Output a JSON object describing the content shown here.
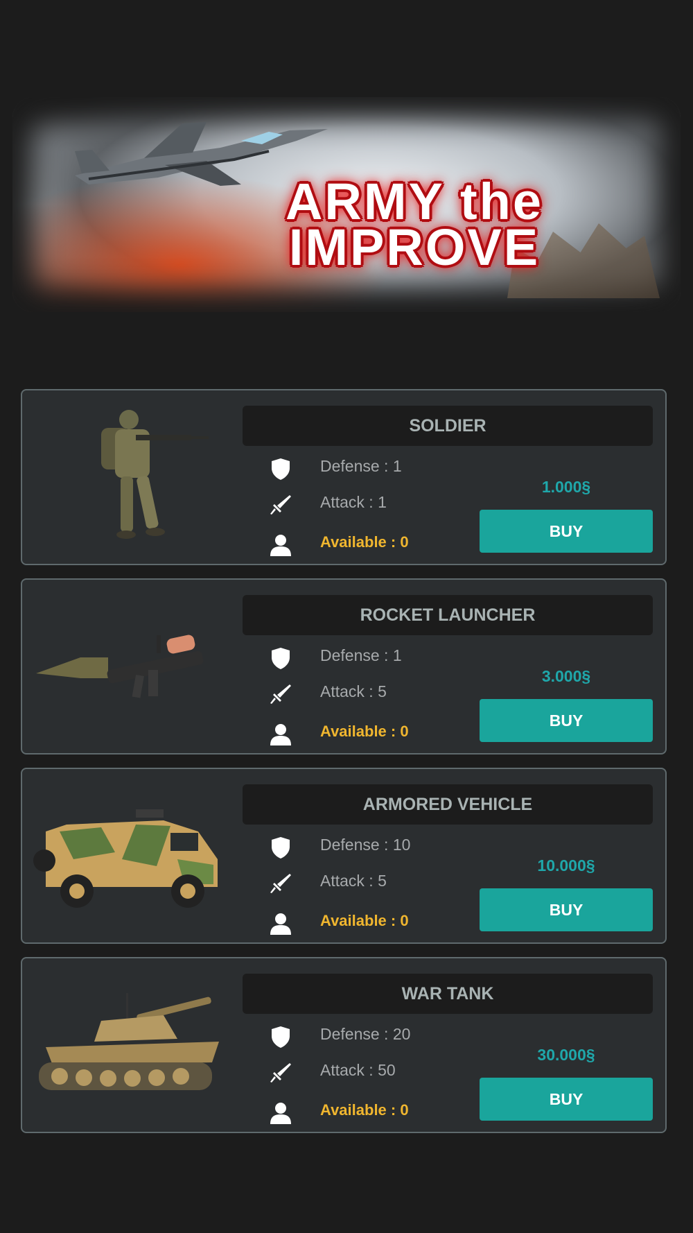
{
  "banner": {
    "title_line1": "ARMY the",
    "title_line2": "IMPROVE"
  },
  "colors": {
    "background": "#1c1c1c",
    "card": "#2b2e30",
    "buy_button": "#1aa59c",
    "price": "#1fa7aa",
    "available": "#f0b62f",
    "name_text": "#a9b3b3"
  },
  "items": [
    {
      "name": "SOLDIER",
      "defense": "Defense : 1",
      "attack": "Attack : 1",
      "available": "Available : 0",
      "price": "1.000§",
      "buy_label": "BUY",
      "image": "soldier"
    },
    {
      "name": "ROCKET LAUNCHER",
      "defense": "Defense : 1",
      "attack": "Attack : 5",
      "available": "Available : 0",
      "price": "3.000§",
      "buy_label": "BUY",
      "image": "rocket-launcher"
    },
    {
      "name": "ARMORED VEHICLE",
      "defense": "Defense : 10",
      "attack": "Attack : 5",
      "available": "Available : 0",
      "price": "10.000§",
      "buy_label": "BUY",
      "image": "armored-vehicle"
    },
    {
      "name": "WAR TANK",
      "defense": "Defense : 20",
      "attack": "Attack : 50",
      "available": "Available : 0",
      "price": "30.000§",
      "buy_label": "BUY",
      "image": "war-tank"
    }
  ],
  "icons": {
    "defense": "shield-icon",
    "attack": "sword-icon",
    "available": "user-icon"
  }
}
